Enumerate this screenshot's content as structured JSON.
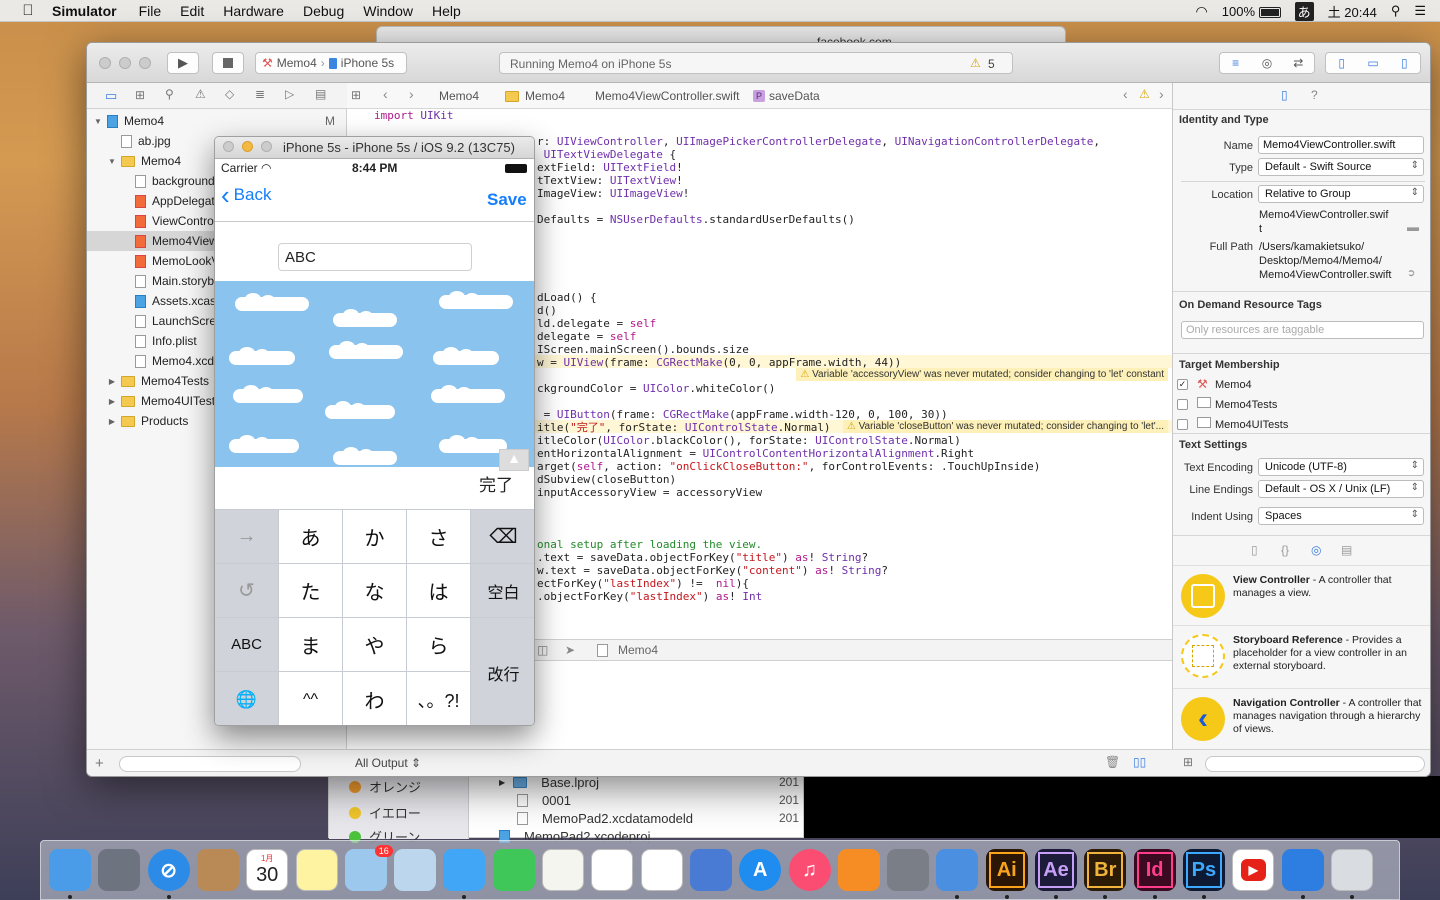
{
  "menubar": {
    "app": "Simulator",
    "items": [
      "File",
      "Edit",
      "Hardware",
      "Debug",
      "Window",
      "Help"
    ],
    "battery": "100%",
    "input_method": "あ",
    "clock": "土 20:44"
  },
  "bg_window": {
    "url": "facebook.com"
  },
  "toolbar": {
    "scheme_target": "Memo4",
    "scheme_device": "iPhone 5s",
    "status_text": "Running Memo4 on iPhone 5s",
    "warning_count": "5"
  },
  "navigator": {
    "items": [
      {
        "label": "Memo4",
        "kind": "project",
        "badge": "M"
      },
      {
        "label": "ab.jpg",
        "kind": "file"
      },
      {
        "label": "Memo4",
        "kind": "folder"
      },
      {
        "label": "background",
        "kind": "file"
      },
      {
        "label": "AppDelegate",
        "kind": "swift"
      },
      {
        "label": "ViewControl",
        "kind": "swift"
      },
      {
        "label": "Memo4View",
        "kind": "swift",
        "selected": true
      },
      {
        "label": "MemoLookV",
        "kind": "swift"
      },
      {
        "label": "Main.storyb",
        "kind": "file"
      },
      {
        "label": "Assets.xcas",
        "kind": "blue"
      },
      {
        "label": "LaunchScre",
        "kind": "file"
      },
      {
        "label": "Info.plist",
        "kind": "file"
      },
      {
        "label": "Memo4.xcda",
        "kind": "file"
      },
      {
        "label": "Memo4Tests",
        "kind": "folder"
      },
      {
        "label": "Memo4UITests",
        "kind": "folder"
      },
      {
        "label": "Products",
        "kind": "folder"
      }
    ]
  },
  "jumpbar": {
    "crumbs": [
      "Memo4",
      "Memo4",
      "Memo4ViewController.swift",
      "saveData"
    ]
  },
  "editor": {
    "lines": [
      "import UIKit",
      "",
      "r: UIViewController, UIImagePickerControllerDelegate, UINavigationControllerDelegate,",
      " UITextViewDelegate {",
      "extField: UITextField!",
      "tTextView: UITextView!",
      "ImageView: UIImageView!",
      "",
      "Defaults = NSUserDefaults.standardUserDefaults()",
      "",
      "",
      "",
      "",
      "",
      "dLoad() {",
      "d()",
      "ld.delegate = self",
      "delegate = self",
      "IScreen.mainScreen().bounds.size",
      "w = UIView(frame: CGRectMake(0, 0, appFrame.width, 44))",
      "",
      "ckgroundColor = UIColor.whiteColor()",
      "",
      " = UIButton(frame: CGRectMake(appFrame.width-120, 0, 100, 30))",
      "itle(\"完了\", forState: UIControlState.Normal)",
      "itleColor(UIColor.blackColor(), forState: UIControlState.Normal)",
      "entHorizontalAlignment = UIControlContentHorizontalAlignment.Right",
      "arget(self, action: \"onClickCloseButton:\", forControlEvents: .TouchUpInside)",
      "dSubview(closeButton)",
      "inputAccessoryView = accessoryView",
      "",
      "",
      "",
      "onal setup after loading the view.",
      ".text = saveData.objectForKey(\"title\") as! String?",
      "w.text = saveData.objectForKey(\"content\") as! String?",
      "ectForKey(\"lastIndex\") !=  nil){",
      ".objectForKey(\"lastIndex\") as! Int"
    ],
    "warning1": "Variable 'accessoryView' was never mutated; consider changing to 'let' constant",
    "warning2": "Variable 'closeButton' was never mutated; consider changing to 'let'..."
  },
  "debugbar": {
    "target": "Memo4"
  },
  "console": {
    "filter": "All Output"
  },
  "inspector": {
    "identity_header": "Identity and Type",
    "name_label": "Name",
    "name_value": "Memo4ViewController.swift",
    "type_label": "Type",
    "type_value": "Default - Swift Source",
    "location_label": "Location",
    "location_value": "Relative to Group",
    "location_file_1": "Memo4ViewController.swif",
    "location_file_2": "t",
    "fullpath_label": "Full Path",
    "fullpath_1": "/Users/kamakietsuko/",
    "fullpath_2": "Desktop/Memo4/Memo4/",
    "fullpath_3": "Memo4ViewController.swift",
    "ondemand_header": "On Demand Resource Tags",
    "ondemand_placeholder": "Only resources are taggable",
    "target_header": "Target Membership",
    "targets": [
      "Memo4",
      "Memo4Tests",
      "Memo4UITests"
    ],
    "text_header": "Text Settings",
    "encoding_label": "Text Encoding",
    "encoding_value": "Unicode (UTF-8)",
    "line_endings_label": "Line Endings",
    "line_endings_value": "Default - OS X / Unix (LF)",
    "indent_label": "Indent Using",
    "indent_value": "Spaces",
    "library": [
      {
        "title": "View Controller",
        "desc": " - A controller that manages a view."
      },
      {
        "title": "Storyboard Reference",
        "desc": " - Provides a placeholder for a view controller in an external storyboard."
      },
      {
        "title": "Navigation Controller",
        "desc": " - A controller that manages navigation through a hierarchy of views."
      }
    ]
  },
  "simulator": {
    "title": "iPhone 5s - iPhone 5s / iOS 9.2 (13C75)",
    "carrier": "Carrier",
    "time": "8:44 PM",
    "back_label": "Back",
    "save_label": "Save",
    "textfield_value": "ABC",
    "done_label": "完了",
    "keyboard": {
      "row1": [
        "→",
        "あ",
        "か",
        "さ",
        "⌫"
      ],
      "row2": [
        "↺",
        "た",
        "な",
        "は",
        "空白"
      ],
      "row3": [
        "ABC",
        "ま",
        "や",
        "ら",
        "改行"
      ],
      "row4": [
        "🌐",
        "^^",
        "わ",
        "、。?!"
      ]
    }
  },
  "finder": {
    "items": [
      "オレンジ",
      "イエロー",
      "グリーン",
      "Base.lproj",
      "0001",
      "MemoPad2.xcdatamodeld",
      "MemoPad2.xcodeproj"
    ],
    "dates": [
      "201",
      "201",
      "201"
    ]
  },
  "dock": {
    "icons": [
      "finder-icon",
      "launchpad-icon",
      "safari-icon",
      "contacts-icon",
      "calendar-icon",
      "notes-icon",
      "mail-icon",
      "preview-icon",
      "messages-icon",
      "facetime-icon",
      "textedit-icon",
      "photos-icon",
      "numbers-icon",
      "keynote-icon",
      "appstore-icon",
      "itunes-icon",
      "ibooks-icon",
      "system-preferences-icon",
      "xcode-icon",
      "illustrator-icon",
      "after-effects-icon",
      "bridge-icon",
      "indesign-icon",
      "photoshop-icon",
      "youtube-icon",
      "simulator-icon",
      "trash-icon"
    ],
    "calendar_month": "1月",
    "calendar_day": "30",
    "mail_badge": "16",
    "ai": "Ai",
    "ae": "Ae",
    "br": "Br",
    "id": "Id",
    "ps": "Ps"
  }
}
